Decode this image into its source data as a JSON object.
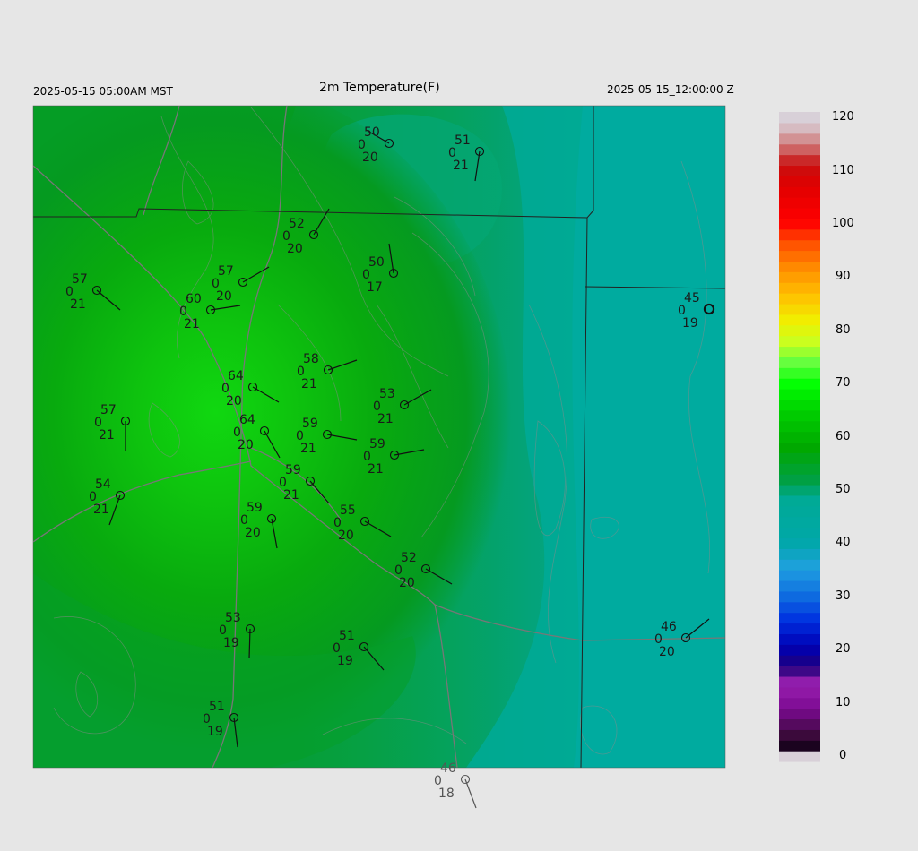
{
  "header": {
    "local_time": "2025-05-15 05:00AM MST",
    "title": "2m Temperature(F)",
    "valid_time": "2025-05-15_12:00:00 Z"
  },
  "colorbar": {
    "labels": [
      "120",
      "110",
      "100",
      "90",
      "80",
      "70",
      "60",
      "50",
      "40",
      "30",
      "20",
      "10",
      "0"
    ]
  },
  "stations": [
    {
      "t": "50",
      "c": "0",
      "d": "20"
    },
    {
      "t": "51",
      "c": "0",
      "d": "21"
    },
    {
      "t": "52",
      "c": "0",
      "d": "20"
    },
    {
      "t": "50",
      "c": "0",
      "d": "17"
    },
    {
      "t": "57",
      "c": "0",
      "d": "21"
    },
    {
      "t": "57",
      "c": "0",
      "d": "20"
    },
    {
      "t": "60",
      "c": "0",
      "d": "21"
    },
    {
      "t": "45",
      "c": "0",
      "d": "19"
    },
    {
      "t": "58",
      "c": "0",
      "d": "21"
    },
    {
      "t": "64",
      "c": "0",
      "d": "20"
    },
    {
      "t": "53",
      "c": "0",
      "d": "21"
    },
    {
      "t": "59",
      "c": "0",
      "d": "21"
    },
    {
      "t": "64",
      "c": "0",
      "d": "20"
    },
    {
      "t": "59",
      "c": "0",
      "d": "21"
    },
    {
      "t": "54",
      "c": "0",
      "d": "21"
    },
    {
      "t": "57",
      "c": "0",
      "d": "21"
    },
    {
      "t": "59",
      "c": "0",
      "d": "21"
    },
    {
      "t": "59",
      "c": "0",
      "d": "20"
    },
    {
      "t": "55",
      "c": "0",
      "d": "20"
    },
    {
      "t": "52",
      "c": "0",
      "d": "20"
    },
    {
      "t": "53",
      "c": "0",
      "d": "19"
    },
    {
      "t": "51",
      "c": "0",
      "d": "19"
    },
    {
      "t": "46",
      "c": "0",
      "d": "20"
    },
    {
      "t": "51",
      "c": "0",
      "d": "19"
    },
    {
      "t": "46",
      "c": "0",
      "d": "18"
    }
  ]
}
